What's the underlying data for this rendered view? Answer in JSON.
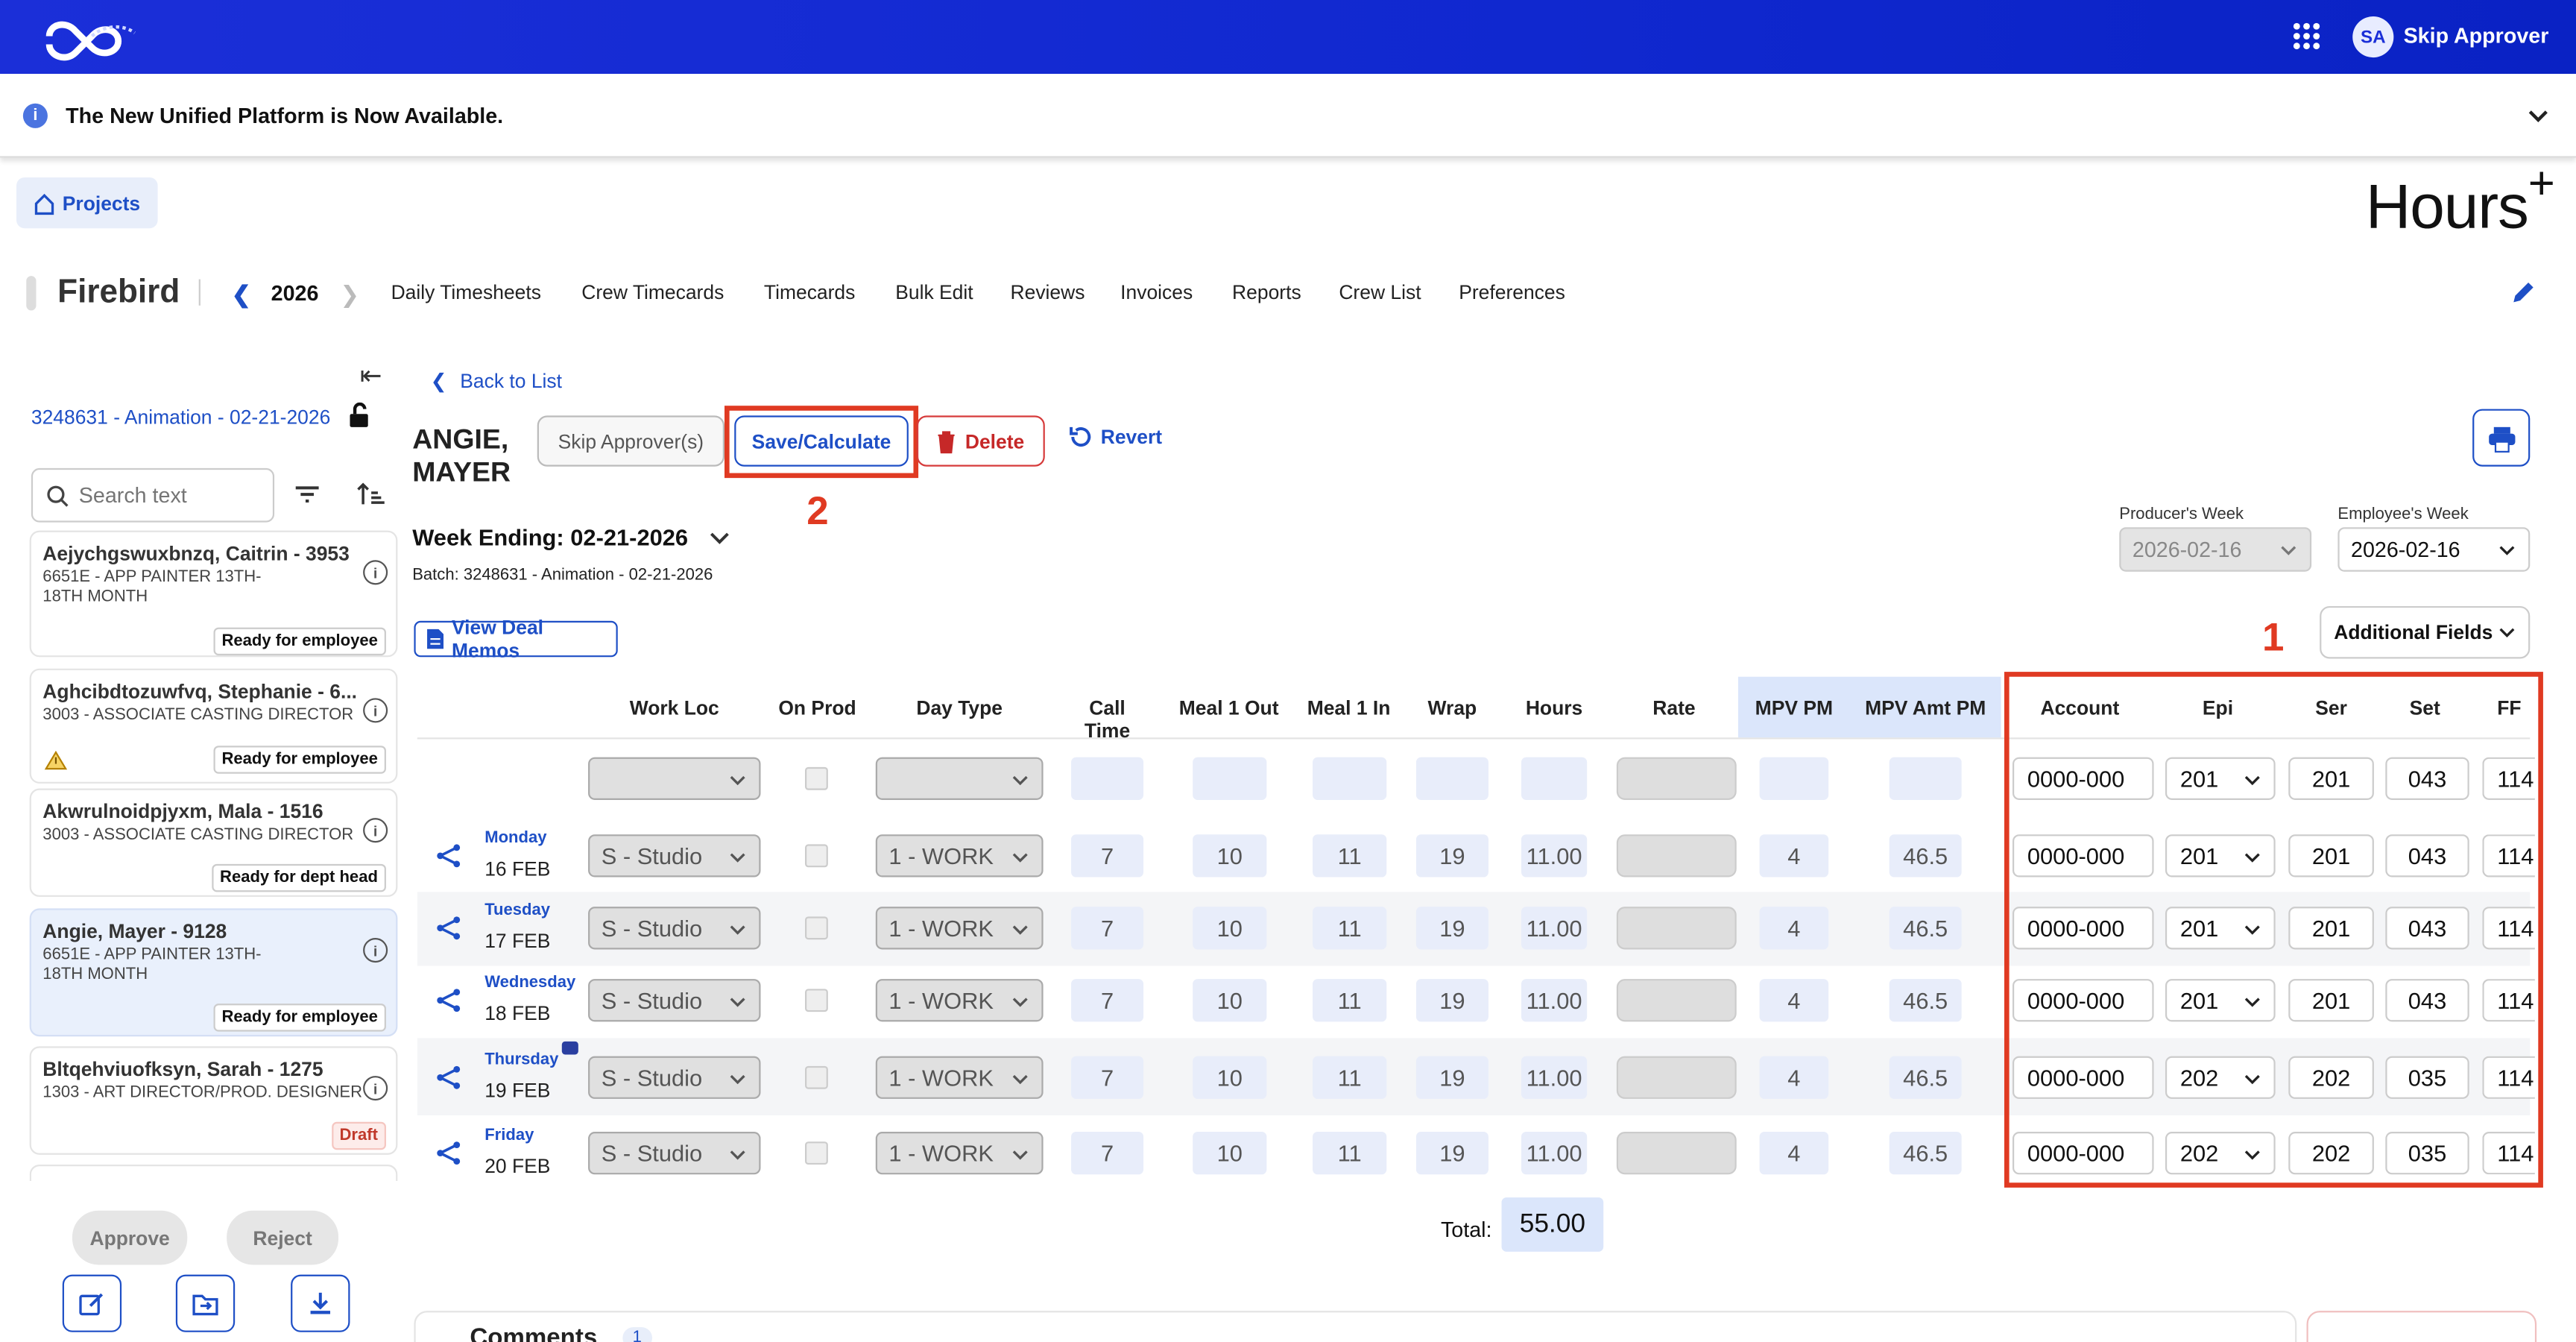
{
  "header": {
    "user_initials": "SA",
    "user_name": "Skip Approver"
  },
  "notice": {
    "text": "The New Unified Platform is Now Available."
  },
  "app": {
    "projects_label": "Projects",
    "title": "Hours",
    "title_sup": "+"
  },
  "nav": {
    "project": "Firebird",
    "year": "2026",
    "links": [
      "Daily Timesheets",
      "Crew Timecards",
      "Timecards",
      "Bulk Edit",
      "Reviews",
      "Invoices",
      "Reports",
      "Crew List",
      "Preferences"
    ]
  },
  "sidebar": {
    "batch": "3248631 - Animation - 02-21-2026",
    "search_placeholder": "Search text",
    "cards": [
      {
        "name": "Aejychgswuxbnzq, Caitrin - 3953",
        "role": "6651E - APP PAINTER 13TH-18TH MONTH",
        "badge": "Ready for employee"
      },
      {
        "name": "Aghcibdtozuwfvq, Stephanie - 6...",
        "role": "3003 - ASSOCIATE CASTING DIRECTOR",
        "badge": "Ready for employee"
      },
      {
        "name": "Akwrulnoidpjyxm, Mala - 1516",
        "role": "3003 - ASSOCIATE CASTING DIRECTOR",
        "badge": "Ready for dept head"
      },
      {
        "name": "Angie, Mayer - 9128",
        "role": "6651E - APP PAINTER 13TH-18TH MONTH",
        "badge": "Ready for employee"
      },
      {
        "name": "Bltqehviuofksyn, Sarah - 1275",
        "role": "1303 - ART DIRECTOR/PROD. DESIGNER",
        "badge": "Draft"
      }
    ],
    "approve": "Approve",
    "reject": "Reject"
  },
  "timecard": {
    "back": "Back to List",
    "employee_first": "ANGIE,",
    "employee_last": "MAYER",
    "skip": "Skip Approver(s)",
    "save": "Save/Calculate",
    "delete": "Delete",
    "revert": "Revert",
    "annotation_1": "1",
    "annotation_2": "2",
    "week_ending": "Week Ending: 02-21-2026",
    "batch": "Batch: 3248631 - Animation - 02-21-2026",
    "producers_week_label": "Producer's Week",
    "producers_week": "2026-02-16",
    "employees_week_label": "Employee's Week",
    "employees_week": "2026-02-16",
    "deal_memos": "View Deal Memos",
    "additional_fields": "Additional Fields",
    "total_label": "Total:",
    "total": "55.00",
    "comments": "Comments",
    "comments_count": "1"
  },
  "columns": [
    "Work Loc",
    "On Prod",
    "Day Type",
    "Call Time",
    "Meal 1 Out",
    "Meal 1 In",
    "Wrap",
    "Hours",
    "Rate",
    "MPV PM",
    "MPV Amt PM",
    "Account",
    "Epi",
    "Ser",
    "Set",
    "FF"
  ],
  "rows": [
    {
      "day": "Monday",
      "date": "16 FEB",
      "loc": "S - Studio",
      "type": "1 - WORK",
      "call": "7",
      "m1out": "10",
      "m1in": "11",
      "wrap": "19",
      "hours": "11.00",
      "mpv": "4",
      "mpvamt": "46.5",
      "account": "0000-000",
      "epi": "201",
      "ser": "201",
      "set": "043",
      "ff": "114"
    },
    {
      "day": "Tuesday",
      "date": "17 FEB",
      "loc": "S - Studio",
      "type": "1 - WORK",
      "call": "7",
      "m1out": "10",
      "m1in": "11",
      "wrap": "19",
      "hours": "11.00",
      "mpv": "4",
      "mpvamt": "46.5",
      "account": "0000-000",
      "epi": "201",
      "ser": "201",
      "set": "043",
      "ff": "114"
    },
    {
      "day": "Wednesday",
      "date": "18 FEB",
      "loc": "S - Studio",
      "type": "1 - WORK",
      "call": "7",
      "m1out": "10",
      "m1in": "11",
      "wrap": "19",
      "hours": "11.00",
      "mpv": "4",
      "mpvamt": "46.5",
      "account": "0000-000",
      "epi": "201",
      "ser": "201",
      "set": "043",
      "ff": "114"
    },
    {
      "day": "Thursday",
      "date": "19 FEB",
      "loc": "S - Studio",
      "type": "1 - WORK",
      "call": "7",
      "m1out": "10",
      "m1in": "11",
      "wrap": "19",
      "hours": "11.00",
      "mpv": "4",
      "mpvamt": "46.5",
      "account": "0000-000",
      "epi": "202",
      "ser": "202",
      "set": "035",
      "ff": "114"
    },
    {
      "day": "Friday",
      "date": "20 FEB",
      "loc": "S - Studio",
      "type": "1 - WORK",
      "call": "7",
      "m1out": "10",
      "m1in": "11",
      "wrap": "19",
      "hours": "11.00",
      "mpv": "4",
      "mpvamt": "46.5",
      "account": "0000-000",
      "epi": "202",
      "ser": "202",
      "set": "035",
      "ff": "114"
    }
  ],
  "blank_row": {
    "account": "0000-000",
    "epi": "201",
    "ser": "201",
    "set": "043",
    "ff": "114"
  },
  "colors": {
    "brand": "#1b2fd8",
    "accent": "#1e4fc6",
    "annotation": "#e03a22"
  }
}
